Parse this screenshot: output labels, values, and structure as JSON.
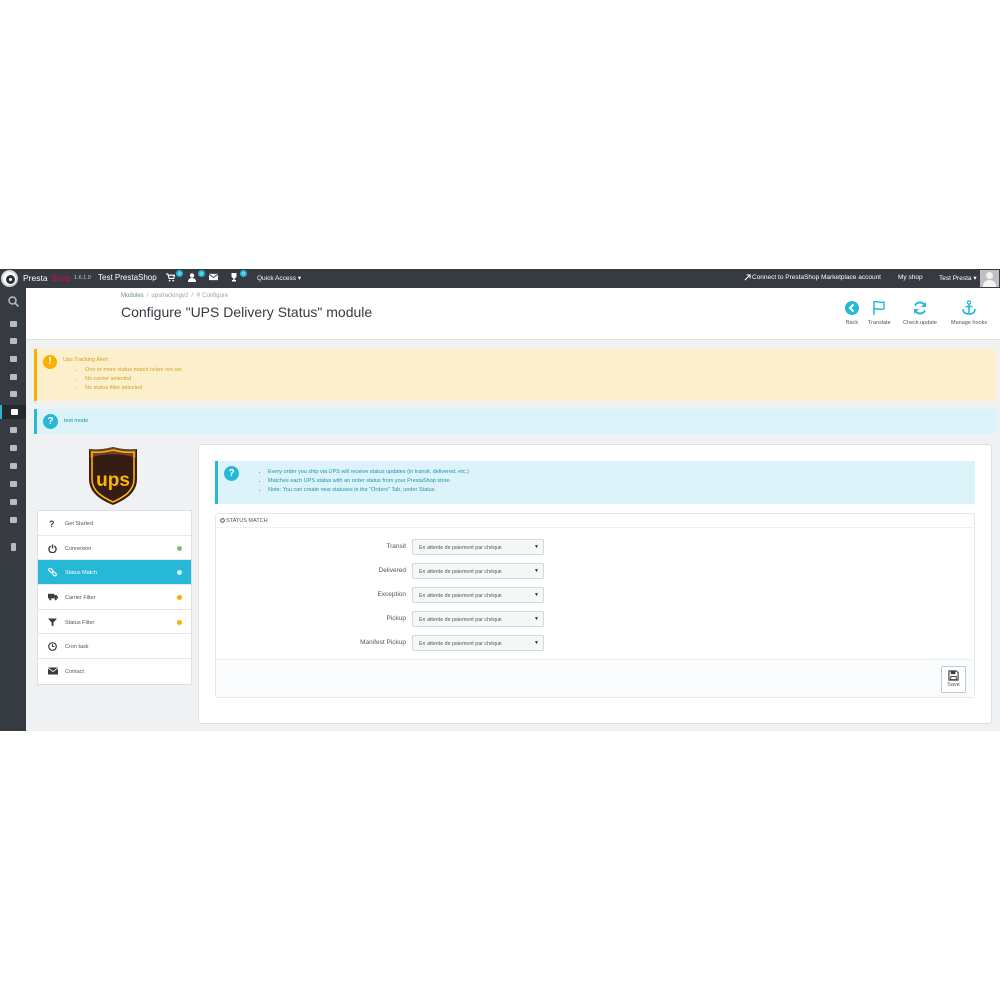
{
  "topbar": {
    "brand_part1": "Presta",
    "brand_part2": "Shop",
    "version": "1.6.1.0",
    "shop_name": "Test PrestaShop",
    "orders_badge": "4",
    "customers_badge": "2",
    "messages_badge": "",
    "trophy_badge": "0",
    "quick_access": "Quick Access",
    "connect_link": "Connect to PrestaShop Marketplace account",
    "my_shop": "My shop",
    "user": "Test Presta"
  },
  "sidebar": {
    "icons": [
      "search-icon",
      "dashboard-icon",
      "orders-icon",
      "catalog-icon",
      "customers-icon",
      "price-rules-icon",
      "modules-icon",
      "shipping-icon",
      "localization-icon",
      "preferences-icon",
      "advanced-parameters-icon",
      "administration-icon",
      "stats-icon",
      "more-icon"
    ]
  },
  "header": {
    "breadcrumb": [
      "Modules",
      "upstrackingv2",
      "Configure"
    ],
    "title": "Configure \"UPS Delivery Status\" module",
    "toolbar": [
      {
        "label": "Back",
        "icon": "back-icon"
      },
      {
        "label": "Translate",
        "icon": "flag-icon"
      },
      {
        "label": "Check update",
        "icon": "refresh-icon"
      },
      {
        "label": "Manage hooks",
        "icon": "anchor-icon"
      }
    ]
  },
  "alerts": {
    "warning_title": "Ups Tracking Alert:",
    "warning_items": [
      "One or more status match is/are not set",
      "No carrier selected",
      "No status filter selected"
    ],
    "info_text": "test mode"
  },
  "menu": {
    "items": [
      {
        "label": "Get Started",
        "icon": "question-icon",
        "status": null,
        "active": false
      },
      {
        "label": "Connexion",
        "icon": "power-icon",
        "status": "#72c279",
        "active": false
      },
      {
        "label": "Status Match",
        "icon": "link-icon",
        "status": "#ffffff",
        "active": true
      },
      {
        "label": "Carrier Filter",
        "icon": "truck-icon",
        "status": "#fab000",
        "active": false
      },
      {
        "label": "Status Filter",
        "icon": "filter-icon",
        "status": "#fab000",
        "active": false
      },
      {
        "label": "Cron task",
        "icon": "clock-icon",
        "status": null,
        "active": false
      },
      {
        "label": "Contact",
        "icon": "envelope-icon",
        "status": null,
        "active": false
      }
    ]
  },
  "info_panel": {
    "items": [
      "Every order you ship via UPS will receive status updates (in transit, delivered, etc.)",
      "Matches each UPS status with an order status from your PrestaShop store.",
      "Note: You can create new statuses in the \"Orders\" Tab, under Status."
    ]
  },
  "status_match": {
    "heading": "STATUS MATCH",
    "rows": [
      {
        "label": "Transit",
        "value": "En attente de paiement par chèque"
      },
      {
        "label": "Delivered",
        "value": "En attente de paiement par chèque"
      },
      {
        "label": "Exception",
        "value": "En attente de paiement par chèque"
      },
      {
        "label": "Pickup",
        "value": "En attente de paiement par chèque"
      },
      {
        "label": "Manifest Pickup",
        "value": "En attente de paiement par chèque"
      }
    ],
    "save_label": "Save"
  },
  "colors": {
    "accent": "#25b9d7",
    "warning": "#fab000",
    "success": "#72c279",
    "topbar": "#363a41"
  }
}
